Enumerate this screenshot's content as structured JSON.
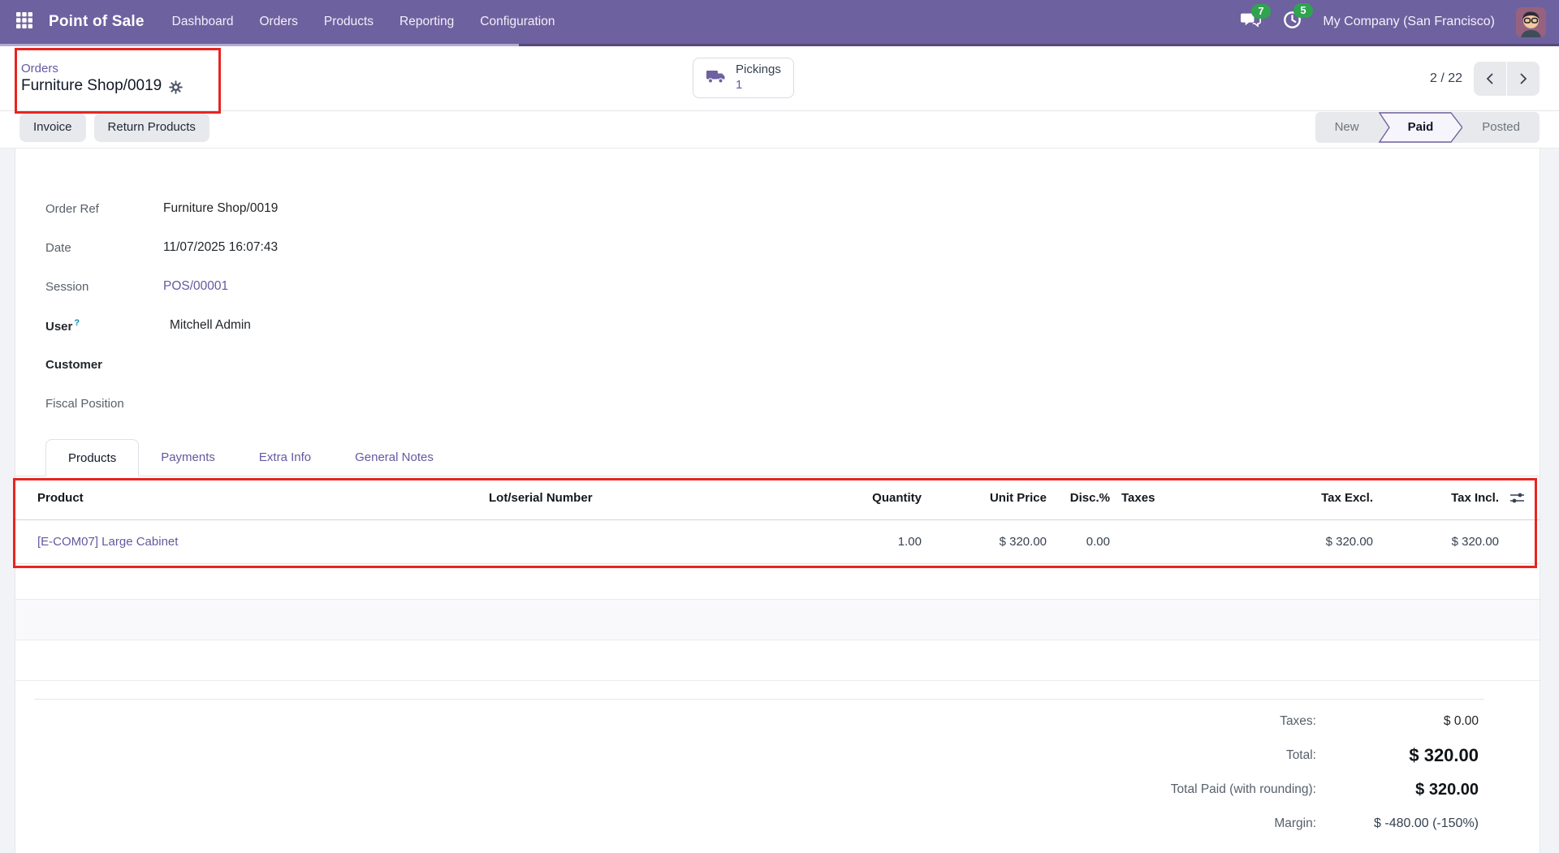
{
  "navbar": {
    "app_name": "Point of Sale",
    "menu": {
      "dashboard": "Dashboard",
      "orders": "Orders",
      "products": "Products",
      "reporting": "Reporting",
      "configuration": "Configuration"
    },
    "messages_badge": "7",
    "activities_badge": "5",
    "company": "My Company (San Francisco)"
  },
  "control_panel": {
    "breadcrumb_parent": "Orders",
    "record_name": "Furniture Shop/0019",
    "pickings": {
      "label": "Pickings",
      "count": "1"
    },
    "pager": "2 / 22"
  },
  "actions": {
    "invoice": "Invoice",
    "return_products": "Return Products"
  },
  "statusbar": {
    "new": "New",
    "paid": "Paid",
    "posted": "Posted"
  },
  "fields": {
    "order_ref": {
      "label": "Order Ref",
      "value": "Furniture Shop/0019"
    },
    "date": {
      "label": "Date",
      "value": "11/07/2025 16:07:43"
    },
    "session": {
      "label": "Session",
      "value": "POS/00001"
    },
    "user": {
      "label": "User",
      "help": "?",
      "value": "Mitchell Admin"
    },
    "customer": {
      "label": "Customer",
      "value": ""
    },
    "fiscal_position": {
      "label": "Fiscal Position",
      "value": ""
    }
  },
  "tabs": {
    "products": "Products",
    "payments": "Payments",
    "extra_info": "Extra Info",
    "general_notes": "General Notes"
  },
  "products_table": {
    "headers": {
      "product": "Product",
      "lot": "Lot/serial Number",
      "quantity": "Quantity",
      "unit_price": "Unit Price",
      "discount": "Disc.%",
      "taxes": "Taxes",
      "tax_excl": "Tax Excl.",
      "tax_incl": "Tax Incl."
    },
    "rows": [
      {
        "product": "[E-COM07] Large Cabinet",
        "lot": "",
        "quantity": "1.00",
        "unit_price": "$ 320.00",
        "discount": "0.00",
        "taxes": "",
        "tax_excl": "$ 320.00",
        "tax_incl": "$ 320.00"
      }
    ]
  },
  "totals": {
    "taxes": {
      "label": "Taxes:",
      "value": "$ 0.00"
    },
    "total": {
      "label": "Total:",
      "value": "$ 320.00"
    },
    "total_paid": {
      "label": "Total Paid (with rounding):",
      "value": "$ 320.00"
    },
    "margin": {
      "label": "Margin:",
      "value": "$ -480.00 (-150%)"
    }
  },
  "colors": {
    "navbar_bg": "#6e619f",
    "accent_purple": "#65589f",
    "badge_green": "#2ea44f",
    "annotation_red": "#e8251f",
    "statusbar_active_fill": "#f7f5fc"
  }
}
